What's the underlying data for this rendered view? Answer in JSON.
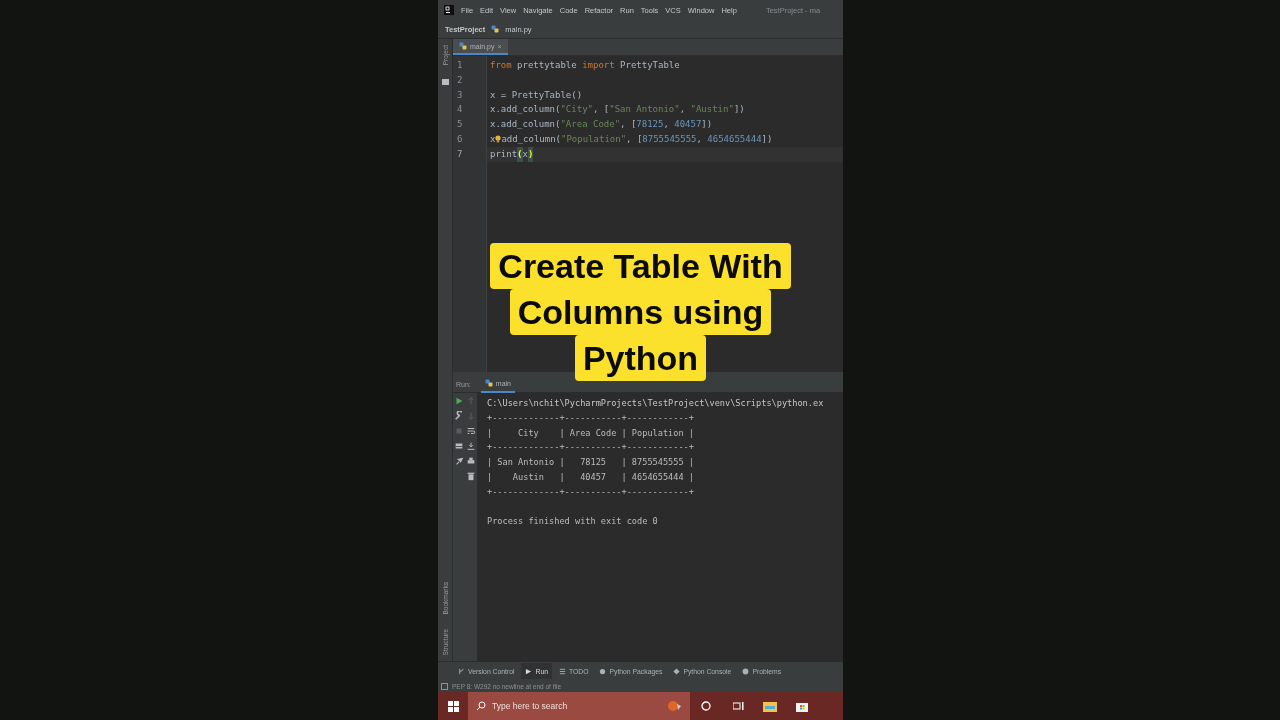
{
  "menu_bar": {
    "items": [
      "File",
      "Edit",
      "View",
      "Navigate",
      "Code",
      "Refactor",
      "Run",
      "Tools",
      "VCS",
      "Window",
      "Help"
    ],
    "title": "TestProject - ma"
  },
  "breadcrumb": [
    "TestProject",
    "main.py"
  ],
  "editor_tabs": [
    {
      "label": "main.py",
      "selected": true,
      "close": "×"
    }
  ],
  "side_strip": {
    "top": [
      "Project"
    ],
    "bottom": [
      "Bookmarks",
      "Structure"
    ]
  },
  "code_lines": [
    {
      "number": "1",
      "current": false,
      "tokens": [
        {
          "text": "from",
          "kind": "keyword"
        },
        {
          "text": " prettytable ",
          "kind": "plain"
        },
        {
          "text": "import",
          "kind": "keyword"
        },
        {
          "text": " PrettyTable",
          "kind": "plain"
        }
      ]
    },
    {
      "number": "2",
      "current": false
    },
    {
      "number": "3",
      "current": false,
      "tokens": [
        {
          "text": "x = PrettyTable()",
          "kind": "plain"
        }
      ]
    },
    {
      "number": "4",
      "current": false,
      "tokens": [
        {
          "text": "x.add_column(",
          "kind": "plain"
        },
        {
          "text": "\"City\"",
          "kind": "string"
        },
        {
          "text": ", [",
          "kind": "plain"
        },
        {
          "text": "\"San Antonio\"",
          "kind": "string"
        },
        {
          "text": ", ",
          "kind": "plain"
        },
        {
          "text": "\"Austin\"",
          "kind": "string"
        },
        {
          "text": "])",
          "kind": "plain"
        }
      ]
    },
    {
      "number": "5",
      "current": false,
      "tokens": [
        {
          "text": "x.add_column(",
          "kind": "plain"
        },
        {
          "text": "\"Area Code\"",
          "kind": "string"
        },
        {
          "text": ", [",
          "kind": "plain"
        },
        {
          "text": "78125",
          "kind": "number"
        },
        {
          "text": ", ",
          "kind": "plain"
        },
        {
          "text": "40457",
          "kind": "number"
        },
        {
          "text": "])",
          "kind": "plain"
        }
      ]
    },
    {
      "number": "6",
      "current": false,
      "tokens": [
        {
          "text": "x",
          "kind": "plain"
        },
        {
          "kind": "bulb"
        },
        {
          "text": "add_column(",
          "kind": "plain"
        },
        {
          "text": "\"Population\"",
          "kind": "string"
        },
        {
          "text": ", [",
          "kind": "plain"
        },
        {
          "text": "8755545555",
          "kind": "number"
        },
        {
          "text": ", ",
          "kind": "plain"
        },
        {
          "text": "4654655444",
          "kind": "number"
        },
        {
          "text": "])",
          "kind": "plain"
        }
      ]
    },
    {
      "number": "7",
      "current": true,
      "tokens": [
        {
          "text": "print",
          "kind": "plain"
        },
        {
          "text": "(",
          "kind": "match"
        },
        {
          "text": "x",
          "kind": "plain"
        },
        {
          "text": ")",
          "kind": "match"
        }
      ]
    }
  ],
  "run_panel": {
    "label": "Run:",
    "tabs": [
      {
        "label": "main",
        "selected": true
      }
    ],
    "output": [
      {
        "text": "C:\\Users\\nchit\\PycharmProjects\\TestProject\\venv\\Scripts\\python.ex",
        "kind": "command"
      },
      {
        "text": "+-------------+-----------+------------+",
        "kind": "table"
      },
      {
        "text": "|     City    | Area Code | Population |",
        "kind": "table"
      },
      {
        "text": "+-------------+-----------+------------+",
        "kind": "table"
      },
      {
        "text": "| San Antonio |   78125   | 8755545555 |",
        "kind": "table"
      },
      {
        "text": "|    Austin   |   40457   | 4654655444 |",
        "kind": "table"
      },
      {
        "text": "+-------------+-----------+------------+",
        "kind": "table"
      },
      {
        "text": "Process finished with exit code 0",
        "kind": "exit"
      }
    ]
  },
  "tool_tabs": [
    {
      "label": "Version Control",
      "selected": false
    },
    {
      "label": "Run",
      "selected": true
    },
    {
      "label": "TODO",
      "selected": false
    },
    {
      "label": "Python Packages",
      "selected": false
    },
    {
      "label": "Python Console",
      "selected": false
    },
    {
      "label": "Problems",
      "selected": false
    }
  ],
  "status_bar": {
    "message": "PEP 8: W292 no newline at end of file"
  },
  "taskbar": {
    "search_placeholder": "Type here to search"
  },
  "caption": [
    "Create Table With",
    "Columns using",
    "Python"
  ]
}
